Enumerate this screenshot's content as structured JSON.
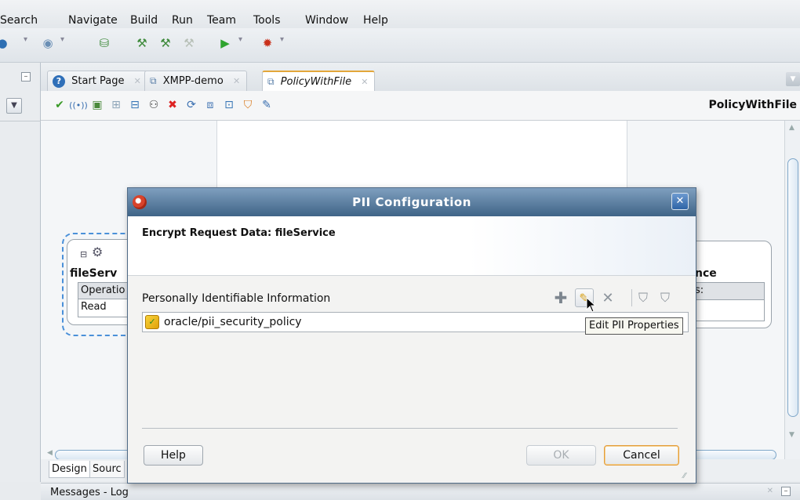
{
  "menu": [
    "Search",
    "Navigate",
    "Build",
    "Run",
    "Team",
    "Tools",
    "Window",
    "Help"
  ],
  "tabs": [
    {
      "label": "Start Page"
    },
    {
      "label": "XMPP-demo"
    },
    {
      "label": "PolicyWithFile"
    }
  ],
  "editor": {
    "title": "PolicyWithFile"
  },
  "canvas": {
    "service_name": "fileServ",
    "service_ops_header": "Operatio",
    "service_op_row": "Read",
    "reference_name": "nce",
    "reference_ops_header": "s:"
  },
  "bottom_tabs": [
    "Design",
    "Sourc"
  ],
  "messages": {
    "title": "Messages - Log"
  },
  "dialog": {
    "title": "PII Configuration",
    "heading": "Encrypt Request Data: fileService",
    "pii_label": "Personally Identifiable Information",
    "pii_item": "oracle/pii_security_policy",
    "tooltip": "Edit PII Properties",
    "help_label": "Help",
    "ok_label": "OK",
    "cancel_label": "Cancel"
  },
  "colors": {
    "dialog_title_bar": "#3f6487",
    "focus_orange": "#e39d3b",
    "selection_blue": "#4a90d9"
  }
}
